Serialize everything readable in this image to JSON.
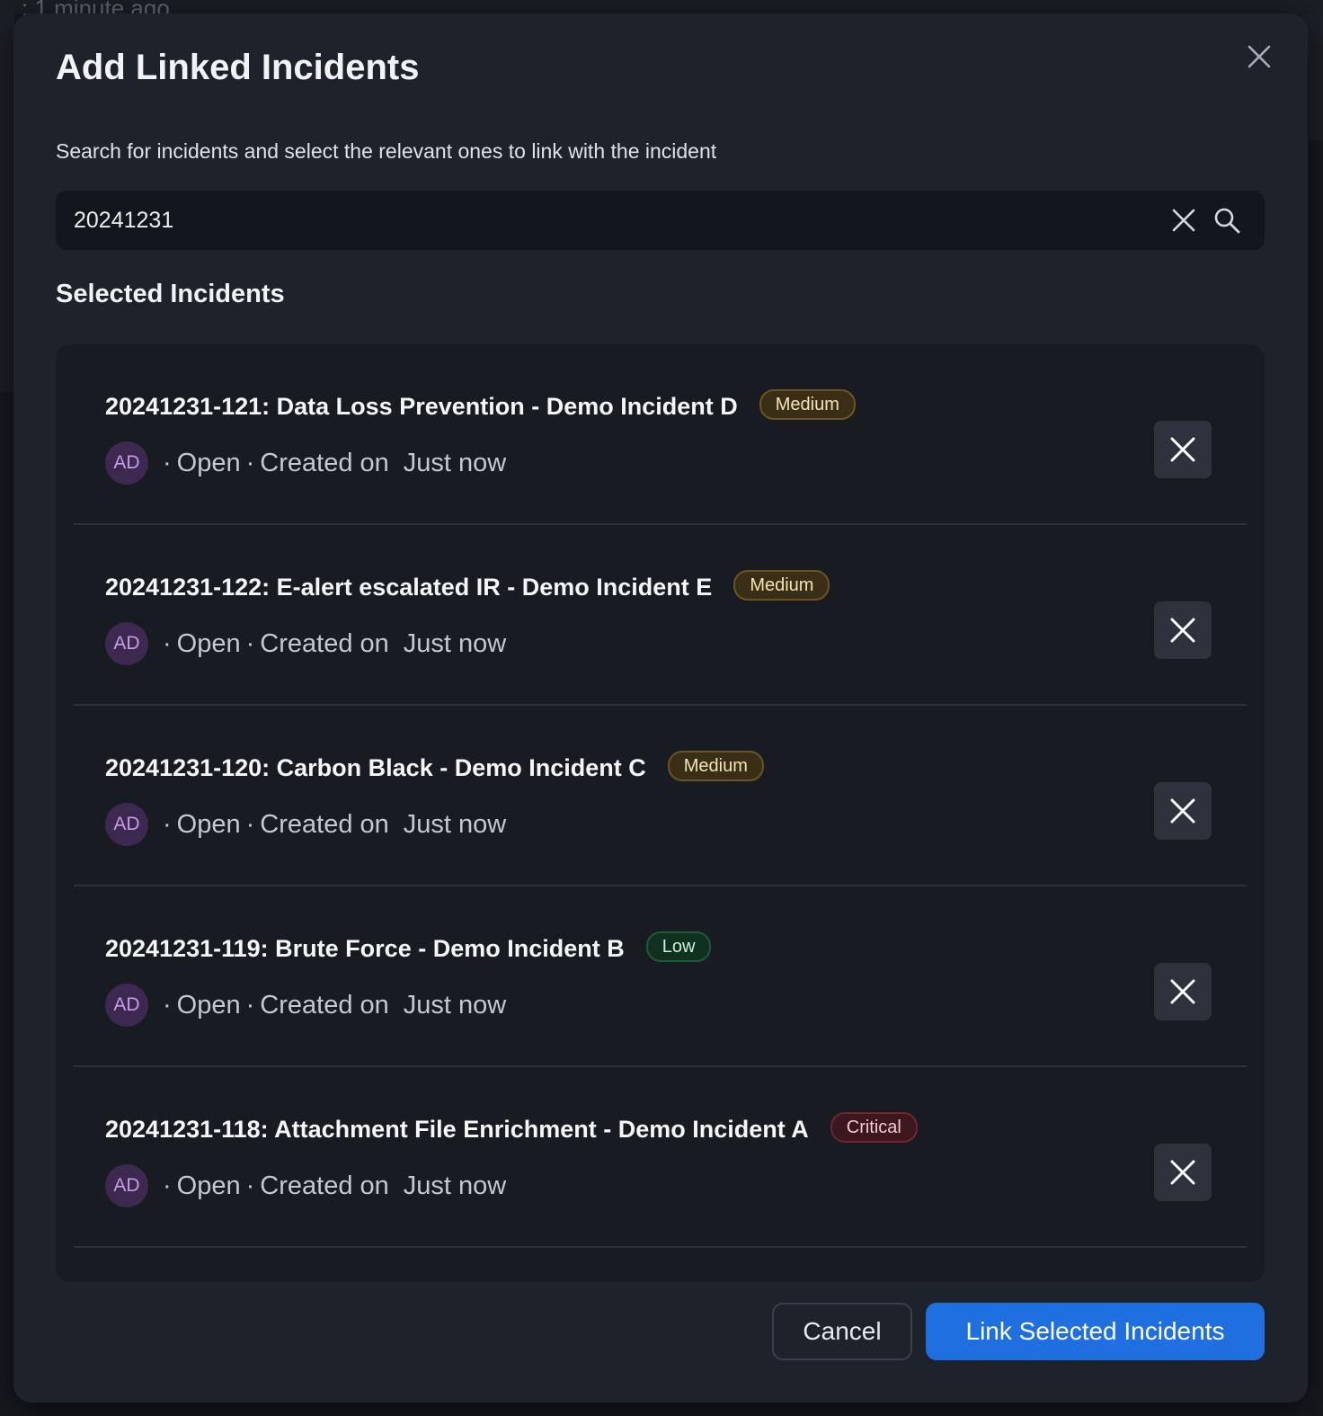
{
  "background": {
    "timestamp": ": 1 minute ago"
  },
  "modal": {
    "title": "Add Linked Incidents",
    "description": "Search for incidents and select the relevant ones to link with the incident",
    "close_icon": "close-icon",
    "search": {
      "value": "20241231",
      "placeholder": "",
      "clear_icon": "close-icon",
      "search_icon": "search-icon"
    },
    "section_title": "Selected Incidents",
    "incidents": [
      {
        "title": "20241231-121: Data Loss Prevention - Demo Incident D",
        "severity": "Medium",
        "avatar": "AD",
        "status": "Open",
        "created_label": "Created on",
        "created_when": "Just now"
      },
      {
        "title": "20241231-122: E-alert escalated IR - Demo Incident E",
        "severity": "Medium",
        "avatar": "AD",
        "status": "Open",
        "created_label": "Created on",
        "created_when": "Just now"
      },
      {
        "title": "20241231-120: Carbon Black - Demo Incident C",
        "severity": "Medium",
        "avatar": "AD",
        "status": "Open",
        "created_label": "Created on",
        "created_when": "Just now"
      },
      {
        "title": "20241231-119: Brute Force - Demo Incident B",
        "severity": "Low",
        "avatar": "AD",
        "status": "Open",
        "created_label": "Created on",
        "created_when": "Just now"
      },
      {
        "title": "20241231-118: Attachment File Enrichment - Demo Incident A",
        "severity": "Critical",
        "avatar": "AD",
        "status": "Open",
        "created_label": "Created on",
        "created_when": "Just now"
      }
    ],
    "separator": "·",
    "cancel_label": "Cancel",
    "link_label": "Link Selected Incidents"
  },
  "colors": {
    "primary_button": "#1f6fe0",
    "severity_medium": "#6b5424",
    "severity_low": "#1d5a36",
    "severity_critical": "#71262f",
    "avatar_bg": "#3d2850"
  }
}
